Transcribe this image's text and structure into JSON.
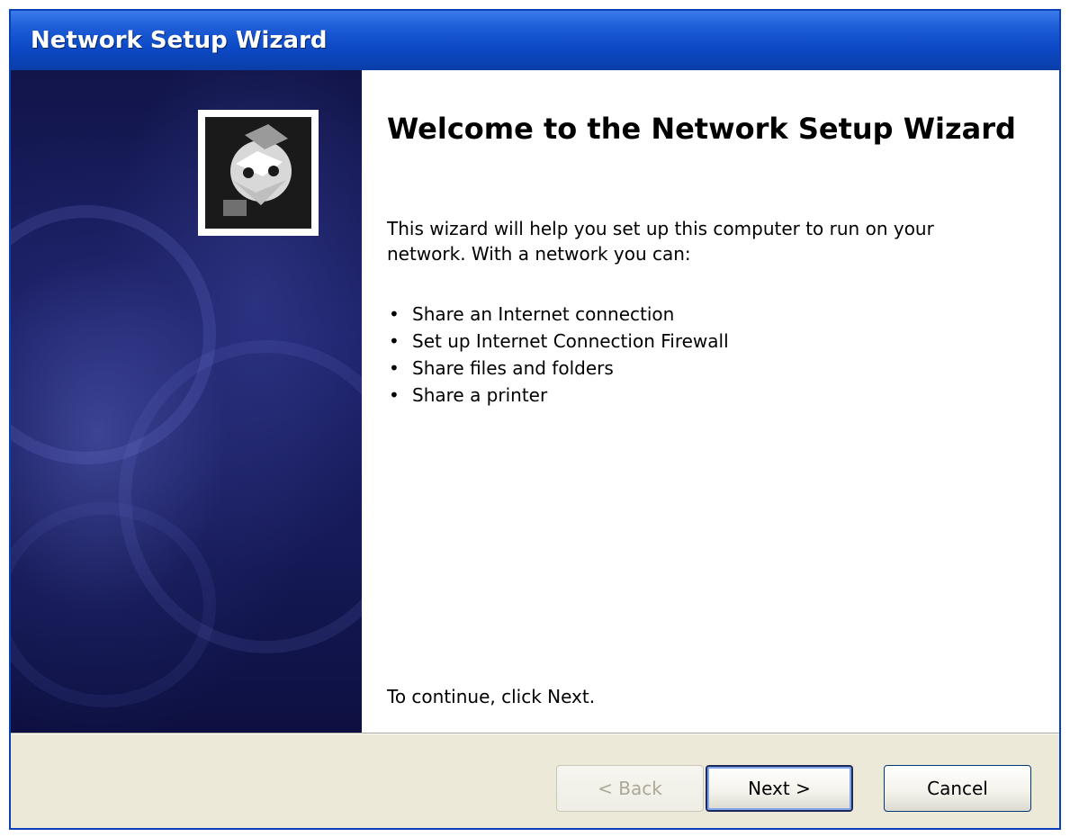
{
  "window": {
    "title": "Network Setup Wizard"
  },
  "emblem": {
    "icon": "network-wizard-icon"
  },
  "content": {
    "heading": "Welcome to the Network Setup Wizard",
    "description": "This wizard will help you set up this computer to run on your network. With a network you can:",
    "features": [
      "Share an Internet connection",
      "Set up Internet Connection Firewall",
      "Share files and folders",
      "Share a printer"
    ],
    "bullet": "•",
    "continue_text": "To continue, click Next."
  },
  "buttons": {
    "back_label": "< Back",
    "next_label": "Next >",
    "cancel_label": "Cancel"
  },
  "colors": {
    "titlebar": "#0d4ac7",
    "sidebar": "#1b2068",
    "dialog_bg": "#ece9d8"
  }
}
